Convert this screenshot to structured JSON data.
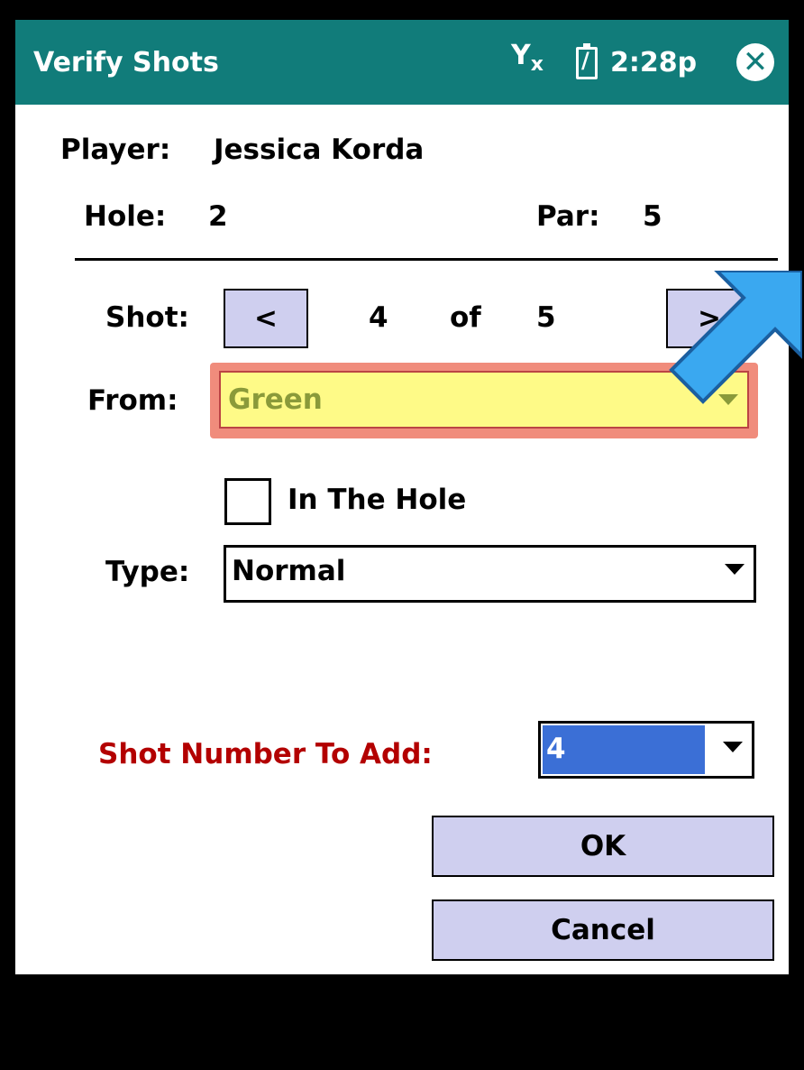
{
  "window": {
    "title": "Verify Shots",
    "time": "2:28p",
    "signal_label": "Y",
    "signal_sub": "x",
    "close_glyph": "✕"
  },
  "player": {
    "label": "Player:",
    "name": "Jessica Korda"
  },
  "hole": {
    "label": "Hole:",
    "value": "2"
  },
  "par": {
    "label": "Par:",
    "value": "5"
  },
  "shot": {
    "label": "Shot:",
    "prev": "<",
    "current": "4",
    "of": "of",
    "total": "5",
    "next": ">"
  },
  "from": {
    "label": "From:",
    "value": "Green"
  },
  "in_the_hole": {
    "label": "In The Hole",
    "checked": false
  },
  "type": {
    "label": "Type:",
    "value": "Normal"
  },
  "shot_number_to_add": {
    "label": "Shot Number To Add:",
    "value": "4",
    "label_color": "#b30000"
  },
  "buttons": {
    "ok": "OK",
    "cancel": "Cancel"
  },
  "colors": {
    "titlebar": "#117c7a",
    "button": "#cfcfef",
    "highlight_select": "#fefa87",
    "arrow": "#3aa8f0"
  }
}
